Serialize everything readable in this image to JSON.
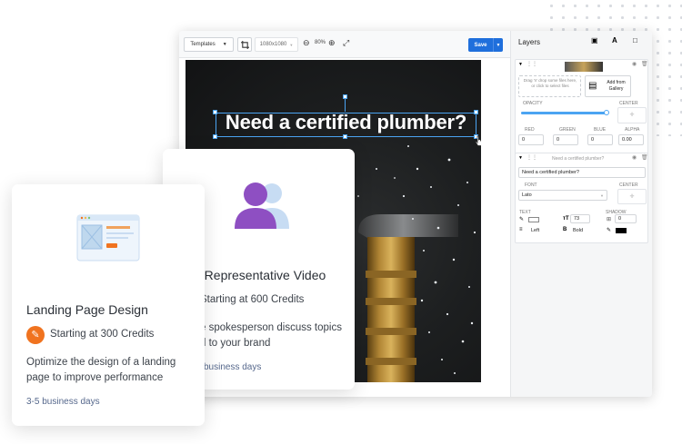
{
  "editor": {
    "toolbar": {
      "templates_label": "Templates",
      "size_label": "1080x1080",
      "zoom_label": "80%",
      "save_label": "Save"
    },
    "canvas": {
      "headline": "Need a certified plumber?"
    },
    "layers_panel": {
      "title": "Layers",
      "image_layer": {
        "drop_hint": "Drag 'n' drop some files here, or click to select files",
        "gallery_label": "Add from Gallery",
        "opacity_label": "OPACITY",
        "center_label": "CENTER",
        "opacity_percent": 100,
        "red_label": "RED",
        "green_label": "GREEN",
        "blue_label": "BLUE",
        "alpha_label": "ALPHA",
        "red": "0",
        "green": "0",
        "blue": "0",
        "alpha": "0.00"
      },
      "text_layer": {
        "layer_name": "Need a certified plumber?",
        "text_value": "Need a certified plumber?",
        "font_label": "FONT",
        "center_label": "CENTER",
        "font_value": "Lato",
        "text_label": "TEXT",
        "shadow_label": "SHADOW",
        "font_size": "73",
        "shadow_value": "0",
        "align_value": "Left",
        "weight_value": "Bold"
      }
    }
  },
  "cards": {
    "video": {
      "title": "d Representative Video",
      "price": "Starting at 600 Credits",
      "description_line1": "e spokesperson discuss topics",
      "description_line2": "d to your brand",
      "delivery": "business days"
    },
    "landing": {
      "title": "Landing Page Design",
      "price": "Starting at 300 Credits",
      "description_line1": "Optimize the design of a landing",
      "description_line2": "page to improve performance",
      "delivery": "3-5 business days"
    }
  },
  "colors": {
    "accent_blue": "#1f6fdc",
    "selection_blue": "#4ba4f2",
    "badge_orange": "#f0731f",
    "avatar_purple": "#8e4fc2",
    "avatar_light_blue": "#c7dcf3"
  },
  "icons": [
    "crop-icon",
    "zoom-out-icon",
    "zoom-in-icon",
    "fit-screen-icon",
    "add-image-icon",
    "add-text-icon",
    "add-shape-icon",
    "gallery-icon",
    "trash-icon",
    "eye-icon",
    "brush-icon",
    "people-icon",
    "browser-mockup-icon"
  ]
}
